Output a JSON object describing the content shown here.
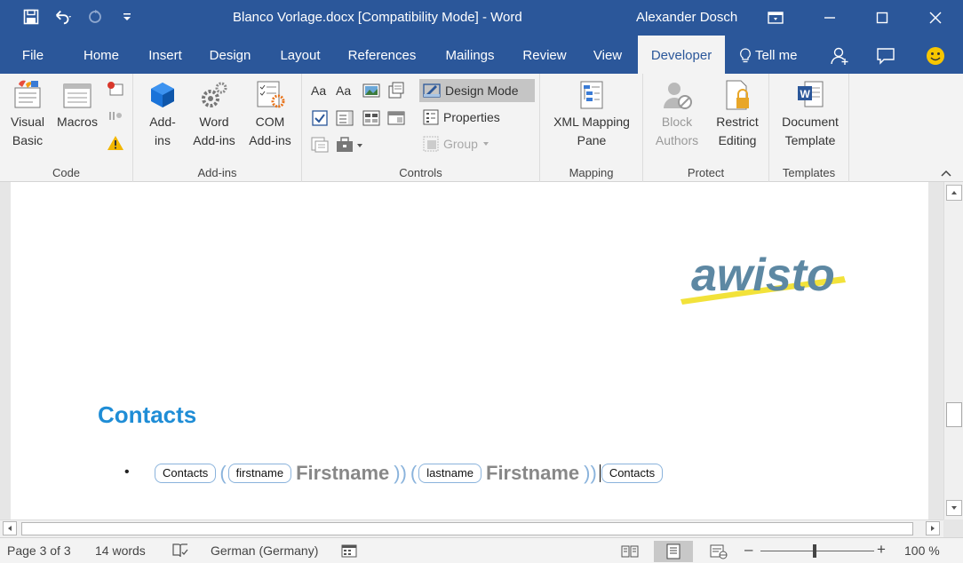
{
  "titlebar": {
    "document_title": "Blanco Vorlage.docx [Compatibility Mode]  -  Word",
    "user_name": "Alexander Dosch"
  },
  "tabs": {
    "file": "File",
    "home": "Home",
    "insert": "Insert",
    "design": "Design",
    "layout": "Layout",
    "references": "References",
    "mailings": "Mailings",
    "review": "Review",
    "view": "View",
    "developer": "Developer",
    "tell_me": "Tell me",
    "active": "Developer"
  },
  "ribbon": {
    "code": {
      "label": "Code",
      "visual_basic": "Visual\nBasic",
      "macros": "Macros"
    },
    "addins": {
      "label": "Add-ins",
      "addins": "Add-\nins",
      "word_addins": "Word\nAdd-ins",
      "com_addins": "COM\nAdd-ins"
    },
    "controls": {
      "label": "Controls",
      "design_mode": "Design Mode",
      "properties": "Properties",
      "group": "Group"
    },
    "mapping": {
      "label": "Mapping",
      "xml_mapping_pane": "XML Mapping\nPane"
    },
    "protect": {
      "label": "Protect",
      "block_authors": "Block\nAuthors",
      "restrict_editing": "Restrict\nEditing"
    },
    "templates": {
      "label": "Templates",
      "document_template": "Document\nTemplate"
    }
  },
  "document": {
    "logo_text": "awisto",
    "heading": "Contacts",
    "bullet": "•",
    "content_controls": {
      "contacts_open": "Contacts",
      "firstname_tag": "firstname",
      "firstname_value": "Firstname",
      "lastname_tag": "lastname",
      "lastname_value": "Firstname",
      "contacts_close": "Contacts"
    }
  },
  "statusbar": {
    "page": "Page 3 of 3",
    "words": "14 words",
    "language": "German (Germany)",
    "zoom_minus": "–",
    "zoom_plus": "+",
    "zoom_level": "100 %"
  },
  "colors": {
    "word_blue": "#2b579a",
    "heading_blue": "#1f8dd6",
    "logo_slate": "#5d88a3",
    "logo_yellow": "#f2e23a"
  }
}
